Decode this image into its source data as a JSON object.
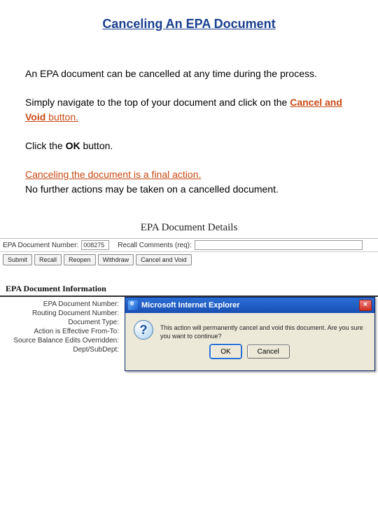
{
  "title": "Canceling An EPA Document",
  "para1": "An EPA document can be cancelled at any time during the process.",
  "para2_a": "Simply navigate to the top of your document and click on the ",
  "para2_b": "Cancel and Void",
  "para2_c": " button.",
  "para3_a": "Click the ",
  "para3_b": "OK",
  "para3_c": " button.",
  "para4_a": "Canceling the document is a final action.",
  "para4_b": "No further actions may be taken on a cancelled document.",
  "app": {
    "header": "EPA Document Details",
    "doc_num_label": "EPA Document Number:",
    "doc_num_value": "008275",
    "recall_label": "Recall Comments (req):",
    "recall_value": "",
    "buttons": {
      "submit": "Submit",
      "recall": "Recall",
      "reopen": "Reopen",
      "withdraw": "Withdraw",
      "cancel_void": "Cancel and Void"
    },
    "info_header": "EPA Document Information",
    "info_rows": [
      "EPA Document Number:",
      "Routing Document Number:",
      "Document Type:",
      "Action is Effective From-To:",
      "Source Balance Edits Overridden:",
      "Dept/SubDept:"
    ]
  },
  "dialog": {
    "title": "Microsoft Internet Explorer",
    "close": "×",
    "icon": "?",
    "message": "This action will permanently cancel and void this document. Are you sure you want to continue?",
    "ok": "OK",
    "cancel": "Cancel"
  }
}
